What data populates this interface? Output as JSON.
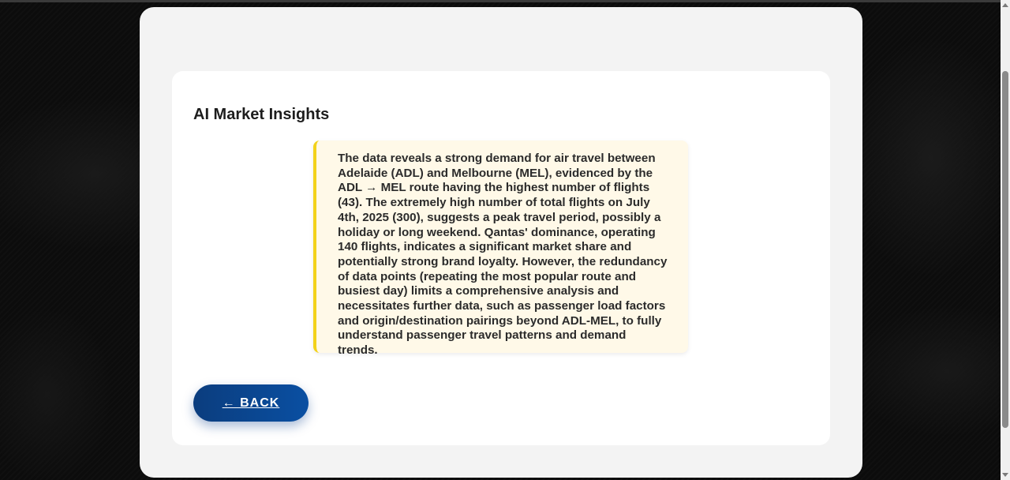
{
  "insights": {
    "title": "AI Market Insights",
    "text": "The data reveals a strong demand for air travel between Adelaide (ADL) and Melbourne (MEL), evidenced by the ADL → MEL route having the highest number of flights (43). The extremely high number of total flights on July 4th, 2025 (300), suggests a peak travel period, possibly a holiday or long weekend. Qantas' dominance, operating 140 flights, indicates a significant market share and potentially strong brand loyalty. However, the redundancy of data points (repeating the most popular route and busiest day) limits a comprehensive analysis and necessitates further data, such as passenger load factors and origin/destination pairings beyond ADL-MEL, to fully understand passenger travel patterns and demand trends."
  },
  "back_button": {
    "label": "← BACK"
  },
  "colors": {
    "accent_yellow": "#f3d21a",
    "button_blue": "#0a4fa2",
    "insight_bg": "#fff9e8"
  }
}
